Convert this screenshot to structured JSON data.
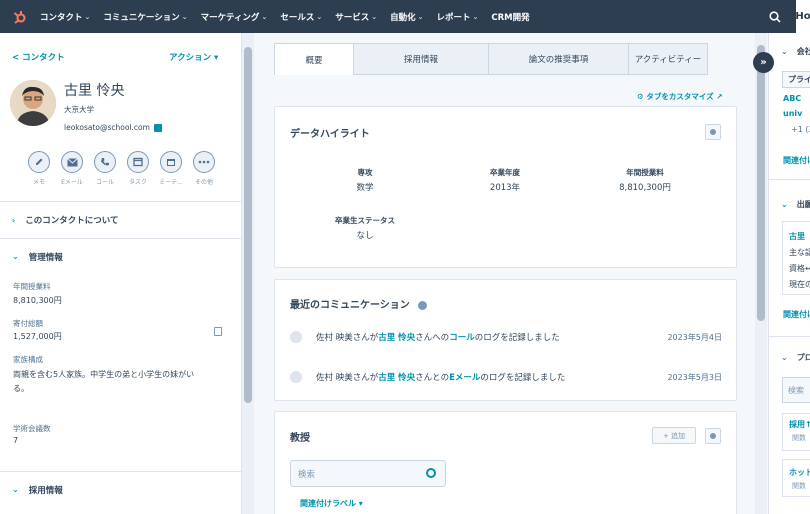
{
  "topnav": {
    "items": [
      "コンタクト",
      "コミュニケーション",
      "マーケティング",
      "セールス",
      "サービス",
      "自動化",
      "レポート",
      "CRM開発"
    ],
    "right_box": "Ho"
  },
  "contact": {
    "back_label": "< コンタクト",
    "actions_label": "アクション ▾",
    "name": "古里 怜央",
    "company": "大京大学",
    "email": "leokosato@school.com",
    "action_buttons": [
      "メモ",
      "Eメール",
      "コール",
      "タスク",
      "ミーテ...",
      "その他"
    ]
  },
  "left_sections": {
    "about": "このコンタクトについて",
    "admin": "管理情報",
    "recruit": "採用情報"
  },
  "admin_props": [
    {
      "label": "年間授業料",
      "value": "8,810,300円"
    },
    {
      "label": "寄付総額",
      "value": "1,527,000円"
    },
    {
      "label": "家族構成",
      "value": "両親を含む5人家族。中学生の弟と小学生の妹がいる。"
    },
    {
      "label": "学術会議数",
      "value": "7"
    }
  ],
  "tabs": [
    "概要",
    "採用情報",
    "論文の推奨事項",
    "アクティビティー"
  ],
  "customize_label": "⚙ タブをカスタマイズ ↗",
  "highlights": {
    "title": "データハイライト",
    "items": [
      {
        "label": "専攻",
        "value": "数学"
      },
      {
        "label": "卒業年度",
        "value": "2013年"
      },
      {
        "label": "年間授業料",
        "value": "8,810,300円"
      },
      {
        "label": "卒業生ステータス",
        "value": "なし"
      }
    ]
  },
  "comms": {
    "title": "最近のコミュニケーション",
    "activities": [
      {
        "pre": "佐村 映美さんが",
        "contact": "古里 怜央",
        "mid": "さんへの",
        "kind": "コール",
        "post": "のログを記録しました",
        "date": "2023年5月4日"
      },
      {
        "pre": "佐村 映美さんが",
        "contact": "古里 怜央",
        "mid": "さんとの",
        "kind": "Eメール",
        "post": "のログを記録しました",
        "date": "2023年5月3日"
      }
    ]
  },
  "professor": {
    "title": "教授",
    "add_label": "+ 追加",
    "search_placeholder": "検索",
    "assoc_label": "関連付けラベル ▾"
  },
  "right": {
    "company_hdr": "会社",
    "company_tag": "プライ",
    "company_link1": "ABC",
    "company_link2": "univ",
    "company_phone": "+1 (3",
    "company_assoc": "関連付け",
    "deals_hdr": "出願",
    "deal_link": "古里",
    "deal_line1": "主な認",
    "deal_line2": "資格↔",
    "deal_line3": "現在の",
    "deal_assoc": "関連付け",
    "third_hdr": "プロ",
    "third_search": "検索",
    "third_link1": "採用↑",
    "third_sub1": "関数",
    "third_link2": "ホット",
    "third_sub2": "関数"
  }
}
